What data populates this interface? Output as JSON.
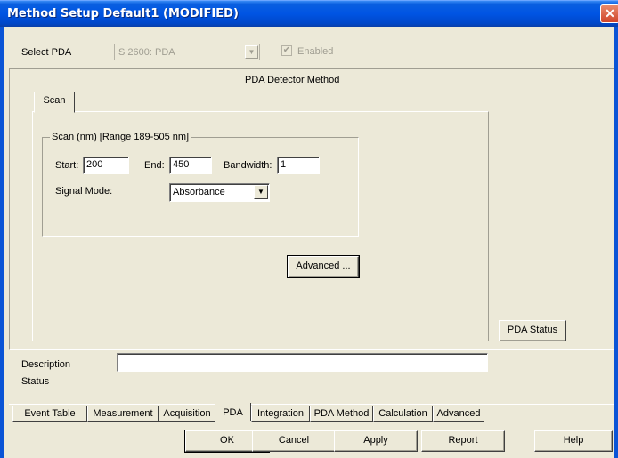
{
  "window": {
    "title": "Method Setup Default1 (MODIFIED)",
    "close_label": "✕"
  },
  "pda_select": {
    "label": "Select PDA",
    "value": "S 2600: PDA",
    "enabled_label": "Enabled",
    "enabled_checked": true
  },
  "pda_method": {
    "heading": "PDA Detector Method",
    "tab_label": "Scan",
    "group_title": "Scan (nm) [Range 189-505 nm]",
    "start_label": "Start:",
    "start_value": "200",
    "end_label": "End:",
    "end_value": "450",
    "bandwidth_label": "Bandwidth:",
    "bandwidth_value": "1",
    "signal_mode_label": "Signal Mode:",
    "signal_mode_value": "Absorbance",
    "advanced_button": "Advanced ..."
  },
  "status_button": "PDA Status",
  "description_label": "Description",
  "description_value": "",
  "status_label": "Status",
  "bottom_tabs": {
    "event_table": "Event Table",
    "measurement": "Measurement",
    "acquisition": "Acquisition",
    "pda": "PDA",
    "integration": "Integration",
    "pda_method": "PDA Method",
    "calculation": "Calculation",
    "advanced": "Advanced"
  },
  "dialog_buttons": {
    "ok": "OK",
    "cancel": "Cancel",
    "apply": "Apply",
    "report": "Report",
    "help": "Help"
  }
}
